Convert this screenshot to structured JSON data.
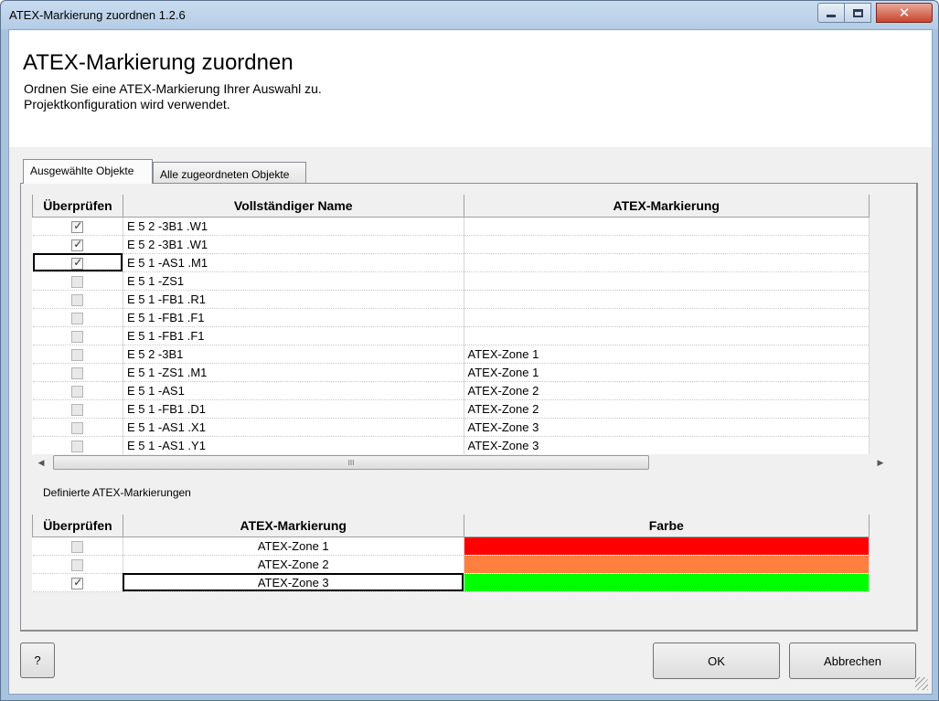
{
  "window": {
    "title": "ATEX-Markierung zuordnen 1.2.6",
    "minimize_icon": "minimize-icon",
    "maximize_icon": "maximize-icon",
    "close_icon": "close-icon",
    "close_glyph": "✕"
  },
  "header": {
    "title": "ATEX-Markierung zuordnen",
    "desc_line1": "Ordnen Sie eine ATEX-Markierung Ihrer Auswahl zu.",
    "desc_line2": "Projektkonfiguration wird verwendet."
  },
  "tabs": [
    {
      "label": "Ausgewählte Objekte",
      "active": true
    },
    {
      "label": "Alle zugeordneten Objekte",
      "active": false
    }
  ],
  "objects_table": {
    "columns": [
      "Überprüfen",
      "Vollständiger Name",
      "ATEX-Markierung"
    ],
    "rows": [
      {
        "checked": true,
        "name": "E 5 2 -3B1 .W1",
        "marking": ""
      },
      {
        "checked": true,
        "name": "E 5 2 -3B1 .W1",
        "marking": ""
      },
      {
        "checked": true,
        "name": "E 5 1 -AS1 .M1",
        "marking": ""
      },
      {
        "checked": false,
        "name": "E 5 1 -ZS1",
        "marking": ""
      },
      {
        "checked": false,
        "name": "E 5 1 -FB1 .R1",
        "marking": ""
      },
      {
        "checked": false,
        "name": "E 5 1 -FB1 .F1",
        "marking": ""
      },
      {
        "checked": false,
        "name": "E 5 1 -FB1 .F1",
        "marking": ""
      },
      {
        "checked": false,
        "name": "E 5 2 -3B1",
        "marking": "ATEX-Zone 1"
      },
      {
        "checked": false,
        "name": "E 5 1 -ZS1 .M1",
        "marking": "ATEX-Zone 1"
      },
      {
        "checked": false,
        "name": "E 5 1 -AS1",
        "marking": "ATEX-Zone 2"
      },
      {
        "checked": false,
        "name": "E 5 1 -FB1 .D1",
        "marking": "ATEX-Zone 2"
      },
      {
        "checked": false,
        "name": "E 5 1 -AS1 .X1",
        "marking": "ATEX-Zone 3"
      },
      {
        "checked": false,
        "name": "E 5 1 -AS1 .Y1",
        "marking": "ATEX-Zone 3"
      }
    ]
  },
  "scrollbar": {
    "left_arrow": "◀",
    "right_arrow": "▶",
    "thumb_grip": "III"
  },
  "defined_section_label": "Definierte ATEX-Markierungen",
  "markings_table": {
    "columns": [
      "Überprüfen",
      "ATEX-Markierung",
      "Farbe"
    ],
    "rows": [
      {
        "checked": false,
        "name": "ATEX-Zone 1",
        "color": "#ff0000"
      },
      {
        "checked": false,
        "name": "ATEX-Zone 2",
        "color": "#ff7f3f"
      },
      {
        "checked": true,
        "name": "ATEX-Zone 3",
        "color": "#00ff00"
      }
    ]
  },
  "buttons": {
    "help": "?",
    "ok": "OK",
    "cancel": "Abbrechen"
  }
}
